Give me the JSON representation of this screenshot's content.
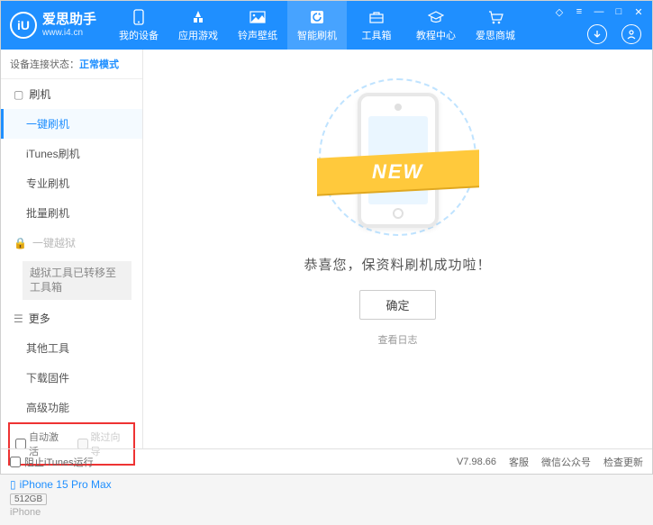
{
  "app": {
    "name": "爱思助手",
    "url": "www.i4.cn",
    "logo_letter": "iU"
  },
  "nav": [
    {
      "label": "我的设备"
    },
    {
      "label": "应用游戏"
    },
    {
      "label": "铃声壁纸"
    },
    {
      "label": "智能刷机",
      "active": true
    },
    {
      "label": "工具箱"
    },
    {
      "label": "教程中心"
    },
    {
      "label": "爱思商城"
    }
  ],
  "connection": {
    "label": "设备连接状态：",
    "status": "正常模式"
  },
  "sidebar": {
    "flash_header": "刷机",
    "flash_items": [
      {
        "label": "一键刷机",
        "active": true
      },
      {
        "label": "iTunes刷机"
      },
      {
        "label": "专业刷机"
      },
      {
        "label": "批量刷机"
      }
    ],
    "jailbreak_header": "一键越狱",
    "jailbreak_note": "越狱工具已转移至工具箱",
    "more_header": "更多",
    "more_items": [
      {
        "label": "其他工具"
      },
      {
        "label": "下载固件"
      },
      {
        "label": "高级功能"
      }
    ],
    "activation": {
      "auto": "自动激活",
      "skip": "跳过向导"
    }
  },
  "device": {
    "name": "iPhone 15 Pro Max",
    "storage": "512GB",
    "type": "iPhone"
  },
  "main": {
    "banner": "NEW",
    "success": "恭喜您，保资料刷机成功啦！",
    "confirm": "确定",
    "viewlog": "查看日志"
  },
  "status": {
    "block_itunes": "阻止iTunes运行",
    "version": "V7.98.66",
    "service": "客服",
    "wechat": "微信公众号",
    "update": "检查更新"
  }
}
